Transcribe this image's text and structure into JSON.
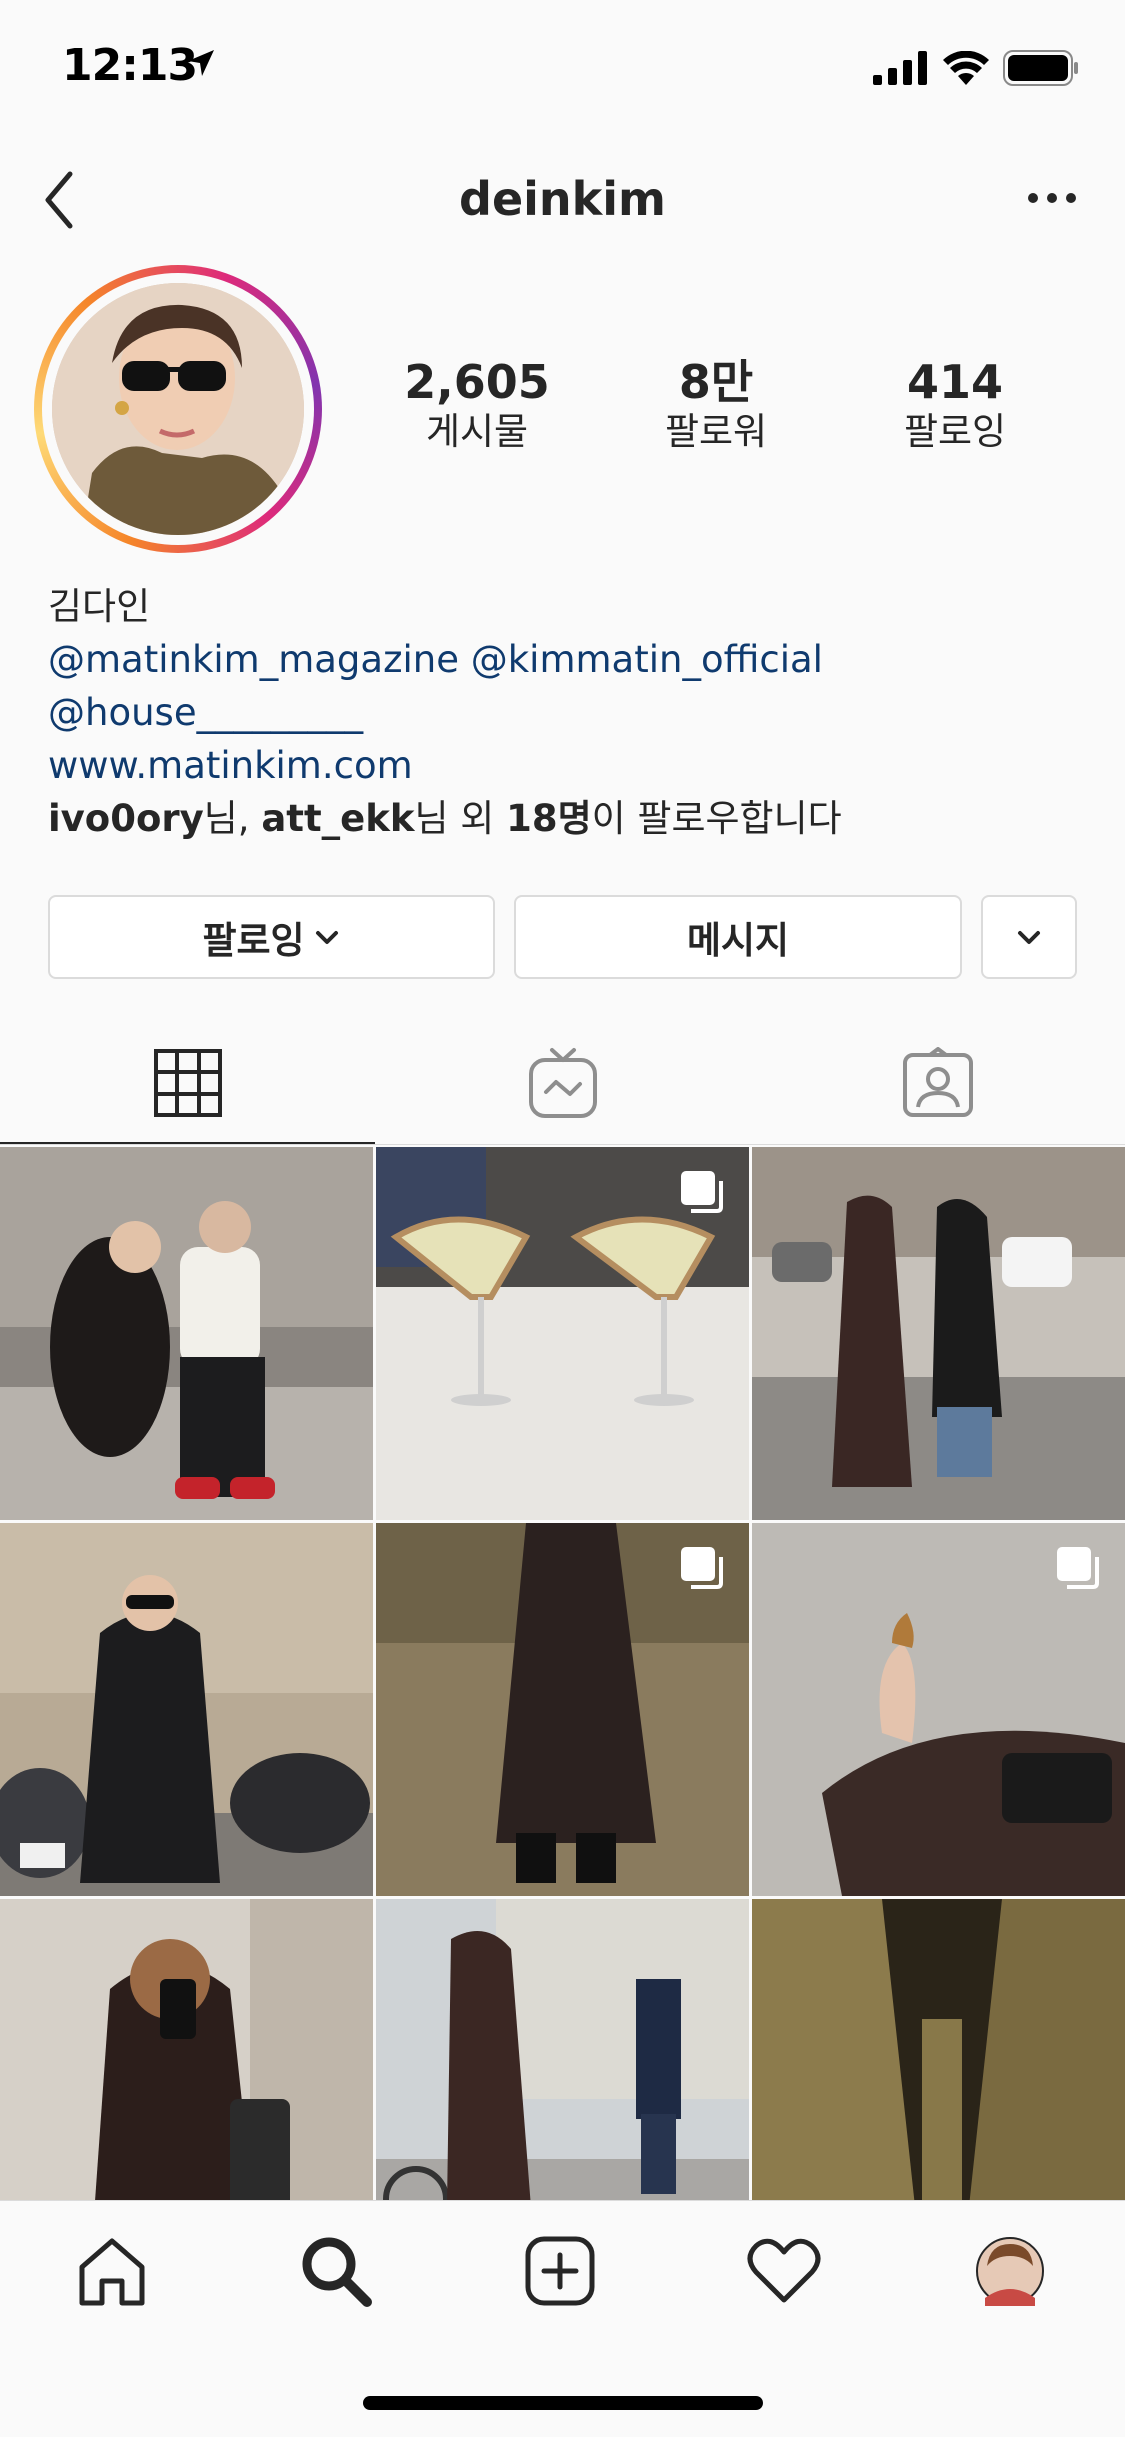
{
  "status_bar": {
    "time": "12:13"
  },
  "header": {
    "username": "deinkim"
  },
  "profile": {
    "stats": [
      {
        "value": "2,605",
        "label": "게시물"
      },
      {
        "value": "8만",
        "label": "팔로워"
      },
      {
        "value": "414",
        "label": "팔로잉"
      }
    ],
    "name": "김다인",
    "mentions_line1": "@matinkim_magazine @kimmatin_official",
    "mentions_line2": "@house_________",
    "website": "www.matinkim.com",
    "followed_by": {
      "user1": "ivo0ory",
      "suffix1": "님, ",
      "user2": "att_ekk",
      "suffix2": "님 외 ",
      "count": "18명",
      "suffix3": "이 팔로우합니다"
    }
  },
  "actions": {
    "following_label": "팔로잉",
    "message_label": "메시지"
  },
  "tabs": [
    "grid-icon",
    "igtv-icon",
    "tagged-icon"
  ],
  "colors": {
    "link": "#0f3a6e",
    "text": "#262626",
    "border": "#dbdbdb"
  }
}
